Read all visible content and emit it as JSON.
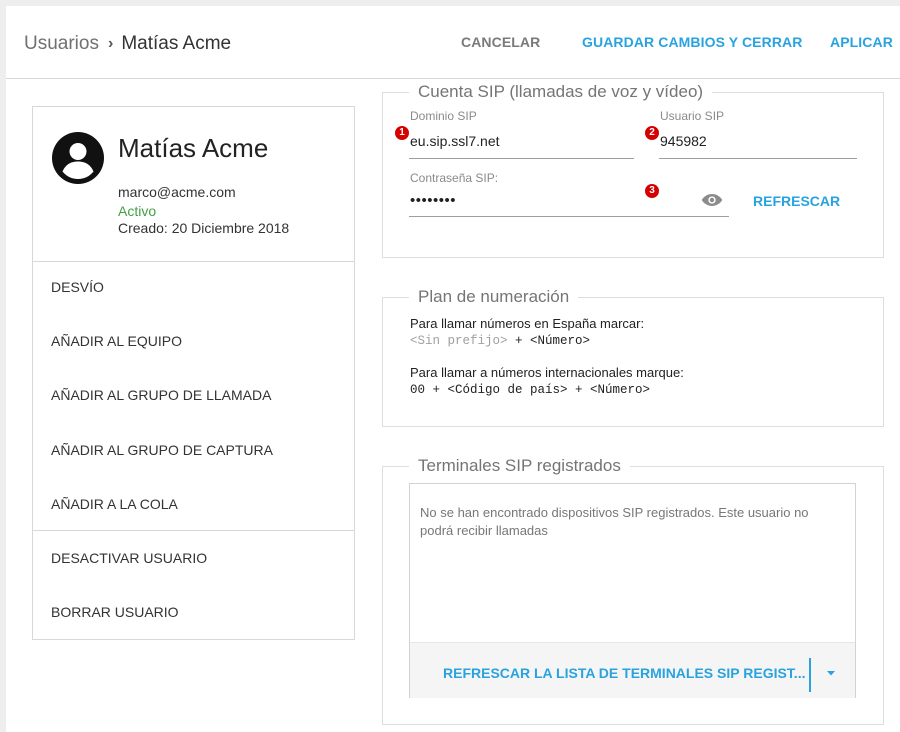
{
  "header": {
    "breadcrumb_root": "Usuarios",
    "breadcrumb_sep": "›",
    "breadcrumb_current": "Matías Acme",
    "cancel_label": "CANCELAR",
    "save_label": "GUARDAR CAMBIOS Y CERRAR",
    "apply_label": "APLICAR"
  },
  "profile": {
    "name": "Matías Acme",
    "email": "marco@acme.com",
    "status": "Activo",
    "created": "Creado: 20 Diciembre 2018",
    "avatar_icon": "account-circle-icon"
  },
  "menu": {
    "items": [
      "DESVÍO",
      "AÑADIR AL EQUIPO",
      "AÑADIR AL GRUPO DE LLAMADA",
      "AÑADIR AL GRUPO DE CAPTURA",
      "AÑADIR A LA COLA"
    ],
    "secondary": [
      "DESACTIVAR USUARIO",
      "BORRAR USUARIO"
    ]
  },
  "sip": {
    "legend": "Cuenta SIP (llamadas de voz y vídeo)",
    "domain_label": "Dominio SIP",
    "domain_value": "eu.sip.ssl7.net",
    "user_label": "Usuario SIP",
    "user_value": "945982",
    "password_label": "Contraseña SIP:",
    "password_value": "••••••••",
    "refresh_label": "REFRESCAR",
    "eye_icon": "visibility-icon",
    "badges": [
      "1",
      "2",
      "3"
    ],
    "badge_color": "#d50000"
  },
  "plan": {
    "legend": "Plan de numeración",
    "spain_text": "Para llamar números en España marcar:",
    "spain_prefix": "<Sin prefijo>",
    "spain_rest": " + <Número>",
    "intl_text": "Para llamar a números internacionales marque:",
    "intl_code": "00 + <Código de país> + <Número>"
  },
  "terminals": {
    "legend": "Terminales SIP registrados",
    "empty_message": "No se han encontrado dispositivos SIP registrados. Este usuario no podrá recibir llamadas",
    "refresh_list_label": "REFRESCAR LA LISTA DE TERMINALES SIP REGIST...",
    "caret_icon": "caret-down-icon"
  },
  "colors": {
    "accent": "#29a3e0",
    "status_active": "#43a047"
  }
}
